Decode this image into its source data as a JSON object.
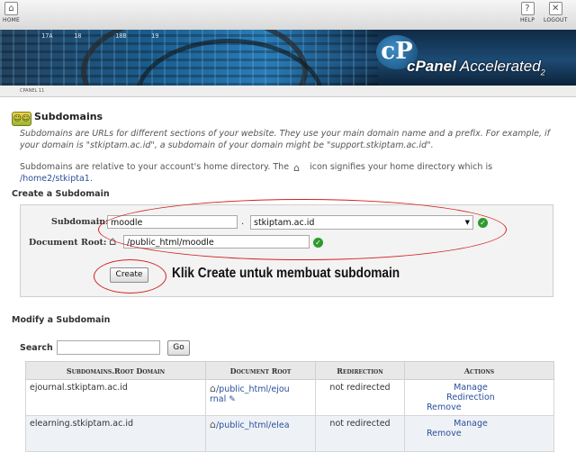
{
  "topbar": {
    "home_label": "HOME",
    "help_label": "HELP",
    "logout_label": "LOGOUT"
  },
  "banner": {
    "numbers": [
      "17A",
      "18",
      "18B",
      "19"
    ],
    "brand": "cPanel",
    "brand_suffix": "Accelerated",
    "brand_version": "2"
  },
  "version_label": "CPANEL 11",
  "page": {
    "title": "Subdomains",
    "desc1": "Subdomains are URLs for different sections of your website. They use your main domain name and a prefix. For example, if your domain is \"stkiptam.ac.id\", a subdomain of your domain might be \"support.stkiptam.ac.id\".",
    "desc2_before": "Subdomains are relative to your account's home directory. The",
    "desc2_after": "icon signifies your home directory which is",
    "home_dir": "/home2/stkipta1."
  },
  "create": {
    "section_title": "Create a Subdomain",
    "subdomain_label": "Subdomain:",
    "subdomain_value": "moodle",
    "dot": ".",
    "domain_selected": "stkiptam.ac.id",
    "docroot_label": "Document Root:",
    "docroot_value": "public_html/moodle",
    "create_button": "Create",
    "annotation": "Klik Create untuk membuat subdomain"
  },
  "modify": {
    "section_title": "Modify a Subdomain",
    "search_label": "Search",
    "search_value": "",
    "go_button": "Go",
    "columns": [
      "Subdomains.Root Domain",
      "Document Root",
      "Redirection",
      "Actions"
    ],
    "rows": [
      {
        "domain": "ejournal.stkiptam.ac.id",
        "docroot": "/public_html/ejou",
        "docroot2": "rnal",
        "redirection": "not redirected",
        "manage": "Manage Redirection",
        "remove": "Remove"
      },
      {
        "domain": "elearning.stkiptam.ac.id",
        "docroot": "/public_html/elea",
        "docroot2": "",
        "redirection": "not redirected",
        "manage": "Manage",
        "remove": "Remove"
      }
    ]
  },
  "colors": {
    "annotation_red": "#d42020",
    "ok_green": "#2e9a2e",
    "link_blue": "#2a4f9a"
  },
  "icons": [
    "home-icon",
    "help-icon",
    "logout-icon",
    "subdomains-icon",
    "house-icon",
    "check-icon",
    "edit-icon"
  ]
}
